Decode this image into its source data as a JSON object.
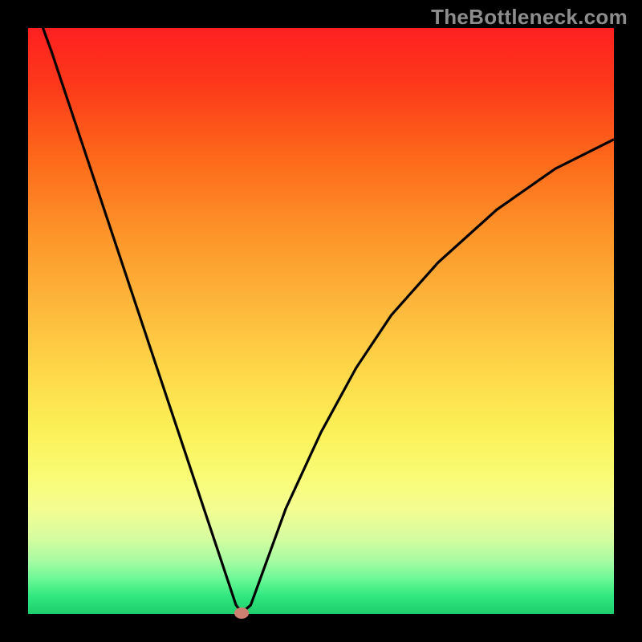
{
  "watermark": "TheBottleneck.com",
  "chart_data": {
    "type": "line",
    "title": "",
    "xlabel": "",
    "ylabel": "",
    "xlim": [
      0,
      100
    ],
    "ylim": [
      0,
      100
    ],
    "grid": false,
    "legend": false,
    "background": "rainbow-vertical-gradient",
    "series": [
      {
        "name": "bottleneck-curve",
        "x": [
          0,
          4,
          8,
          12,
          16,
          20,
          24,
          28,
          32,
          35.5,
          36.5,
          38,
          40,
          44,
          50,
          56,
          62,
          70,
          80,
          90,
          100
        ],
        "y": [
          107,
          96,
          84,
          72,
          60,
          48,
          36,
          24,
          12,
          1.5,
          0.2,
          1.5,
          7,
          18,
          31,
          42,
          51,
          60,
          69,
          76,
          81
        ]
      }
    ],
    "marker": {
      "x": 36.5,
      "y": 0.2,
      "color": "#cf8171"
    }
  }
}
